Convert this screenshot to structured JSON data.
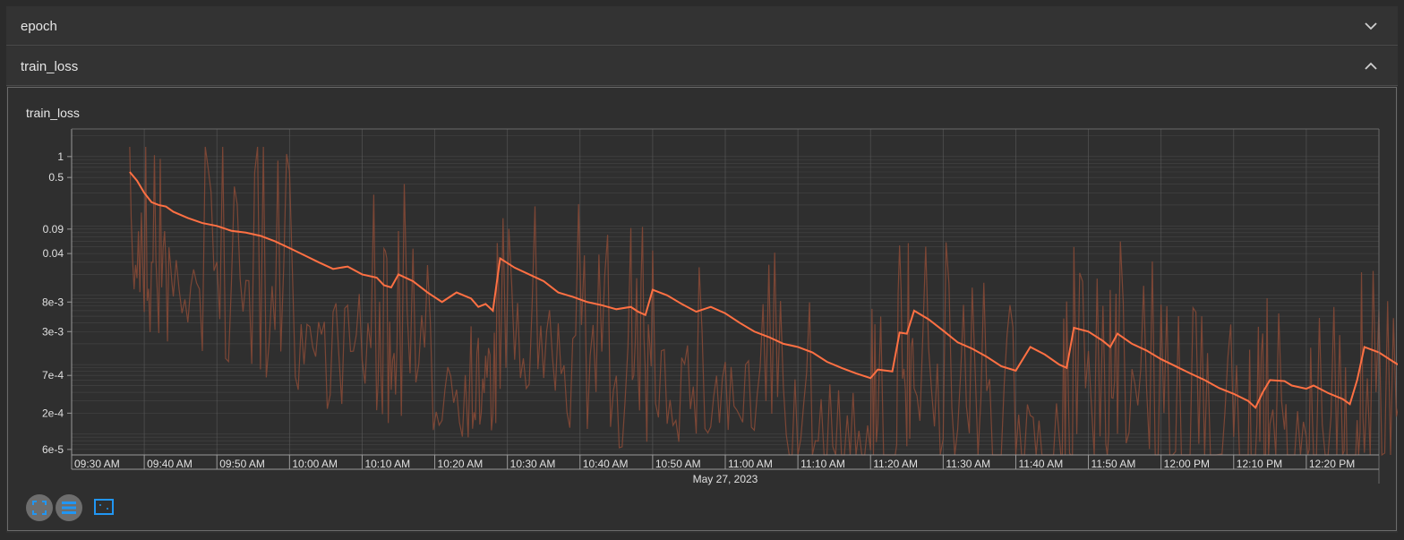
{
  "sections": [
    {
      "label": "epoch",
      "expanded": false
    },
    {
      "label": "train_loss",
      "expanded": true
    }
  ],
  "card": {
    "title": "train_loss"
  },
  "toolbar": [
    {
      "icon": "fit-domain-icon"
    },
    {
      "icon": "legend-list-icon"
    },
    {
      "icon": "zoom-box-icon"
    }
  ],
  "colors": {
    "smoothed": "#ff7043",
    "raw": "#8a4a36",
    "grid": "#585858",
    "text": "#e0e0e0",
    "icon_blue": "#2196f3"
  },
  "chart_data": {
    "type": "line",
    "title": "train_loss",
    "x_axis": {
      "type": "time",
      "ticks": [
        "09:30 AM",
        "09:40 AM",
        "09:50 AM",
        "10:00 AM",
        "10:10 AM",
        "10:20 AM",
        "10:30 AM",
        "10:40 AM",
        "10:50 AM",
        "11:00 AM",
        "11:10 AM",
        "11:20 AM",
        "11:30 AM",
        "11:40 AM",
        "11:50 AM",
        "12:00 PM",
        "12:10 PM",
        "12:20 PM"
      ],
      "date_label": "May 27, 2023",
      "range": [
        "09:30 AM",
        "12:30 PM"
      ]
    },
    "y_axis": {
      "scale": "log",
      "tick_labels": [
        "1",
        "0.5",
        "0.09",
        "0.04",
        "8e-3",
        "3e-3",
        "7e-4",
        "2e-4",
        "6e-5"
      ],
      "tick_values": [
        1,
        0.5,
        0.09,
        0.04,
        0.008,
        0.003,
        0.0007,
        0.0002,
        6e-05
      ],
      "range": [
        5e-05,
        2.5
      ]
    },
    "grid": true,
    "series": [
      {
        "role": "smoothed",
        "points": [
          [
            "09:38",
            0.6
          ],
          [
            "09:39",
            0.45
          ],
          [
            "09:40",
            0.3
          ],
          [
            "09:41",
            0.22
          ],
          [
            "09:42",
            0.2
          ],
          [
            "09:43",
            0.19
          ],
          [
            "09:44",
            0.16
          ],
          [
            "09:46",
            0.13
          ],
          [
            "09:48",
            0.11
          ],
          [
            "09:50",
            0.1
          ],
          [
            "09:52",
            0.085
          ],
          [
            "09:54",
            0.08
          ],
          [
            "09:56",
            0.072
          ],
          [
            "09:58",
            0.06
          ],
          [
            "10:00",
            0.048
          ],
          [
            "10:02",
            0.038
          ],
          [
            "10:04",
            0.03
          ],
          [
            "10:06",
            0.024
          ],
          [
            "10:08",
            0.026
          ],
          [
            "10:10",
            0.02
          ],
          [
            "10:12",
            0.018
          ],
          [
            "10:13",
            0.014
          ],
          [
            "10:14",
            0.013
          ],
          [
            "10:15",
            0.02
          ],
          [
            "10:17",
            0.016
          ],
          [
            "10:19",
            0.011
          ],
          [
            "10:21",
            0.008
          ],
          [
            "10:23",
            0.011
          ],
          [
            "10:25",
            0.009
          ],
          [
            "10:26",
            0.0068
          ],
          [
            "10:27",
            0.0075
          ],
          [
            "10:28",
            0.006
          ],
          [
            "10:29",
            0.034
          ],
          [
            "10:31",
            0.025
          ],
          [
            "10:33",
            0.02
          ],
          [
            "10:35",
            0.016
          ],
          [
            "10:37",
            0.011
          ],
          [
            "10:39",
            0.0095
          ],
          [
            "10:41",
            0.008
          ],
          [
            "10:43",
            0.0072
          ],
          [
            "10:45",
            0.0063
          ],
          [
            "10:47",
            0.0068
          ],
          [
            "10:48",
            0.0058
          ],
          [
            "10:49",
            0.0052
          ],
          [
            "10:50",
            0.012
          ],
          [
            "10:52",
            0.01
          ],
          [
            "10:54",
            0.0075
          ],
          [
            "10:56",
            0.0058
          ],
          [
            "10:58",
            0.0068
          ],
          [
            "11:00",
            0.0055
          ],
          [
            "11:02",
            0.004
          ],
          [
            "11:04",
            0.003
          ],
          [
            "11:06",
            0.0025
          ],
          [
            "11:08",
            0.002
          ],
          [
            "11:10",
            0.0018
          ],
          [
            "11:12",
            0.0015
          ],
          [
            "11:14",
            0.0011
          ],
          [
            "11:16",
            0.0009
          ],
          [
            "11:18",
            0.00075
          ],
          [
            "11:20",
            0.00064
          ],
          [
            "11:21",
            0.00085
          ],
          [
            "11:23",
            0.0008
          ],
          [
            "11:24",
            0.0029
          ],
          [
            "11:25",
            0.0028
          ],
          [
            "11:26",
            0.006
          ],
          [
            "11:28",
            0.0045
          ],
          [
            "11:30",
            0.0031
          ],
          [
            "11:32",
            0.0021
          ],
          [
            "11:34",
            0.0017
          ],
          [
            "11:36",
            0.0013
          ],
          [
            "11:38",
            0.00095
          ],
          [
            "11:40",
            0.00082
          ],
          [
            "11:42",
            0.0018
          ],
          [
            "11:44",
            0.0014
          ],
          [
            "11:46",
            0.001
          ],
          [
            "11:47",
            0.0009
          ],
          [
            "11:48",
            0.0034
          ],
          [
            "11:50",
            0.003
          ],
          [
            "11:52",
            0.0022
          ],
          [
            "11:53",
            0.0018
          ],
          [
            "11:54",
            0.0028
          ],
          [
            "11:56",
            0.002
          ],
          [
            "11:58",
            0.0016
          ],
          [
            "12:00",
            0.0012
          ],
          [
            "12:02",
            0.00095
          ],
          [
            "12:04",
            0.00075
          ],
          [
            "12:06",
            0.0006
          ],
          [
            "12:08",
            0.00046
          ],
          [
            "12:10",
            0.00038
          ],
          [
            "12:12",
            0.0003
          ],
          [
            "12:13",
            0.00024
          ],
          [
            "12:14",
            0.0004
          ],
          [
            "12:15",
            0.0006
          ],
          [
            "12:17",
            0.00058
          ],
          [
            "12:18",
            0.0005
          ],
          [
            "12:20",
            0.00045
          ],
          [
            "12:21",
            0.0005
          ],
          [
            "12:23",
            0.00039
          ],
          [
            "12:25",
            0.00032
          ],
          [
            "12:26",
            0.00027
          ],
          [
            "12:27",
            0.0006
          ],
          [
            "12:28",
            0.0018
          ],
          [
            "12:30",
            0.0015
          ],
          [
            "12:32",
            0.0011
          ],
          [
            "12:34",
            0.00082
          ],
          [
            "12:35",
            0.0011
          ],
          [
            "12:37",
            0.0009
          ],
          [
            "12:38",
            0.00075
          ]
        ]
      }
    ]
  }
}
